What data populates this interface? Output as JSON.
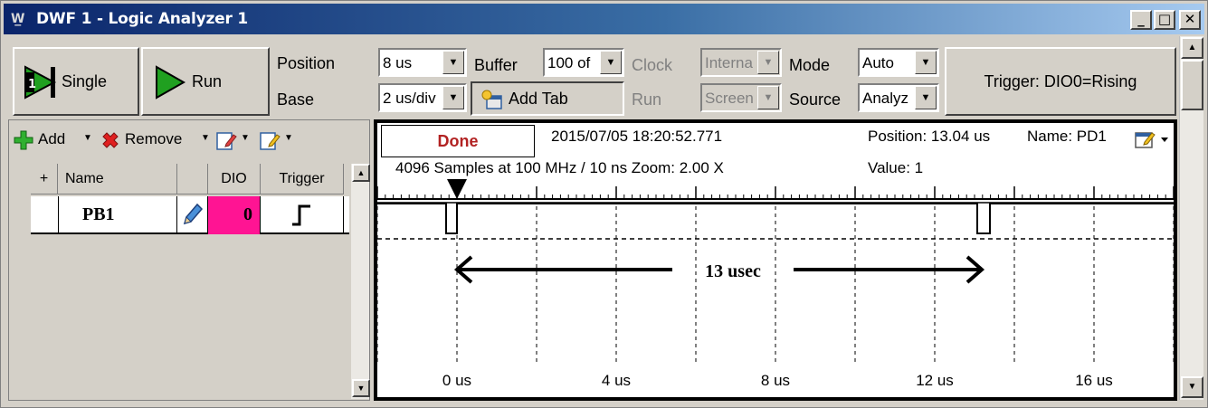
{
  "window": {
    "title": "DWF 1 - Logic Analyzer 1",
    "app_icon_glyph": "W̲",
    "controls": {
      "minimize": "_",
      "maximize": "□",
      "close": "✕"
    }
  },
  "toolbar": {
    "single_label": "Single",
    "run_label": "Run",
    "position_label": "Position",
    "position_value": "8 us",
    "base_label": "Base",
    "base_value": "2 us/div",
    "buffer_label": "Buffer",
    "buffer_value": "100 of",
    "add_tab_label": "Add Tab",
    "clock_label": "Clock",
    "clock_value": "Interna",
    "run_mode_label": "Run",
    "run_mode_value": "Screen",
    "mode_label": "Mode",
    "mode_value": "Auto",
    "source_label": "Source",
    "source_value": "Analyz",
    "trigger_label": "Trigger: DIO0=Rising"
  },
  "channels_panel": {
    "add_label": "Add",
    "remove_label": "Remove",
    "columns": {
      "plus": "+",
      "name": "Name",
      "dio": "DIO",
      "trigger": "Trigger"
    },
    "rows": [
      {
        "name": "PB1",
        "dio": "0",
        "trigger_icon": "rising-edge-icon"
      }
    ],
    "dio_color": "#ff1493"
  },
  "waveform": {
    "status": "Done",
    "status_color": "#b22222",
    "timestamp": "2015/07/05  18:20:52.771",
    "samples_info": "4096 Samples at 100 MHz / 10 ns Zoom: 2.00 X",
    "position_readout": "Position: 13.04 us",
    "name_readout": "Name: PD1",
    "value_readout": "Value: 1",
    "time_axis_labels": [
      "0 us",
      "4 us",
      "8 us",
      "12 us",
      "16 us"
    ],
    "annotation": "13 usec"
  }
}
